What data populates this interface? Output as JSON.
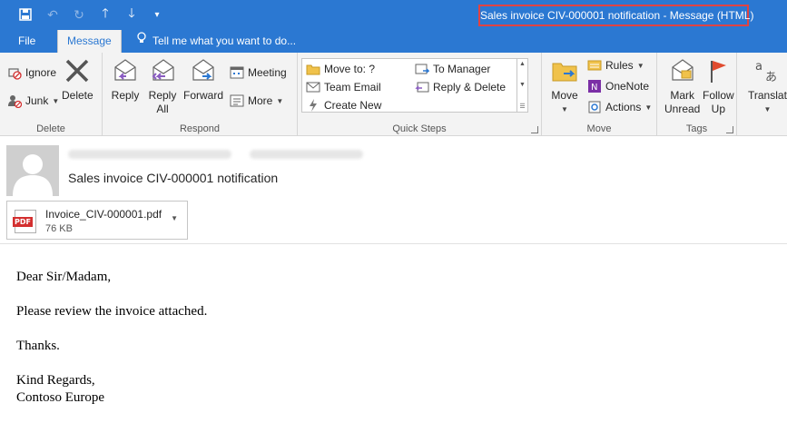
{
  "window": {
    "title": "Sales invoice CIV-000001 notification - Message (HTML)"
  },
  "quick_access": [
    "save-icon",
    "undo-icon",
    "redo-icon",
    "up-arrow-icon",
    "down-arrow-icon",
    "customize-icon"
  ],
  "tabs": {
    "file": "File",
    "message": "Message",
    "tell_me": "Tell me what you want to do..."
  },
  "ribbon": {
    "delete_group": {
      "label": "Delete",
      "ignore": "Ignore",
      "junk": "Junk",
      "delete": "Delete"
    },
    "respond_group": {
      "label": "Respond",
      "reply": "Reply",
      "reply_all_1": "Reply",
      "reply_all_2": "All",
      "forward": "Forward",
      "meeting": "Meeting",
      "more": "More"
    },
    "quick_steps": {
      "label": "Quick Steps",
      "move_to": "Move to: ?",
      "team_email": "Team Email",
      "create_new": "Create New",
      "to_manager": "To Manager",
      "reply_delete": "Reply & Delete"
    },
    "move_group": {
      "label": "Move",
      "move": "Move",
      "rules": "Rules",
      "onenote": "OneNote",
      "actions": "Actions"
    },
    "tags_group": {
      "label": "Tags",
      "mark_unread_1": "Mark",
      "mark_unread_2": "Unread",
      "follow_up_1": "Follow",
      "follow_up_2": "Up"
    },
    "translate_group": {
      "translate": "Translat"
    }
  },
  "message": {
    "subject": "Sales invoice CIV-000001 notification",
    "attachment": {
      "name": "Invoice_CIV-000001.pdf",
      "size": "76 KB",
      "type_badge": "PDF"
    },
    "body": {
      "greeting": "Dear Sir/Madam,",
      "line1": "Please review the invoice attached.",
      "line2": "Thanks.",
      "signoff": "Kind Regards,",
      "signature": "Contoso Europe"
    }
  },
  "colors": {
    "accent": "#2b78d2",
    "highlight_border": "#e04343",
    "ribbon_bg": "#f3f3f3"
  }
}
